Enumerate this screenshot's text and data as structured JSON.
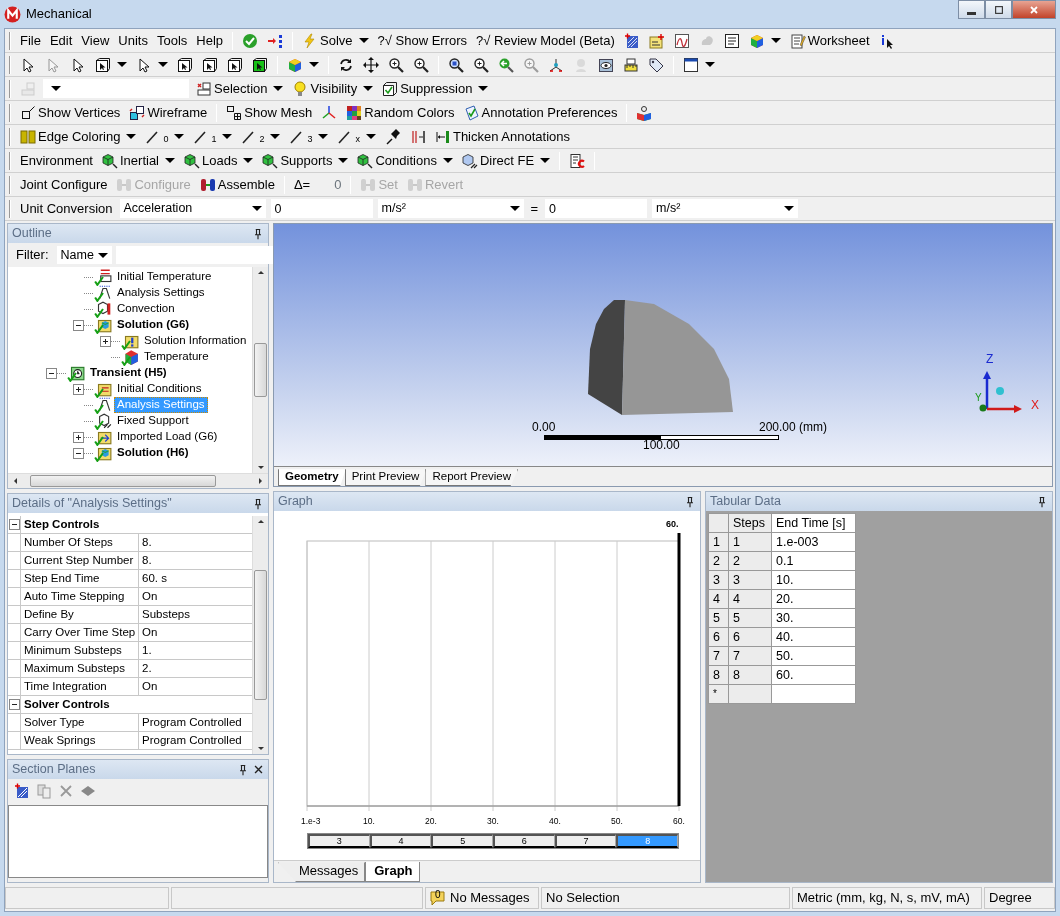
{
  "window": {
    "title": "Mechanical"
  },
  "toolbars": [
    [
      {
        "kind": "menu",
        "label": "File"
      },
      {
        "kind": "menu",
        "label": "Edit"
      },
      {
        "kind": "menu",
        "label": "View"
      },
      {
        "kind": "menu",
        "label": "Units"
      },
      {
        "kind": "menu",
        "label": "Tools"
      },
      {
        "kind": "menu",
        "label": "Help"
      },
      {
        "kind": "sep"
      },
      {
        "kind": "icon",
        "disabled": false
      },
      {
        "kind": "icon",
        "disabled": false
      },
      {
        "kind": "sep"
      },
      {
        "kind": "button",
        "label": "Solve",
        "dropdown": true,
        "disabled": false
      },
      {
        "kind": "text",
        "label": "?√ Show Errors",
        "disabled": false
      },
      {
        "kind": "text",
        "label": "?√ Review Model (Beta)",
        "disabled": false
      },
      {
        "kind": "icon",
        "disabled": false
      },
      {
        "kind": "icon",
        "disabled": false
      },
      {
        "kind": "icon",
        "disabled": false
      },
      {
        "kind": "icon",
        "disabled": true
      },
      {
        "kind": "icon",
        "disabled": false
      },
      {
        "kind": "icon",
        "dropdown": true,
        "disabled": false
      },
      {
        "kind": "button",
        "label": "Worksheet",
        "disabled": false
      },
      {
        "kind": "icon",
        "disabled": false
      }
    ],
    [
      {
        "kind": "icon",
        "disabled": false
      },
      {
        "kind": "icon",
        "disabled": true
      },
      {
        "kind": "icon",
        "disabled": false
      },
      {
        "kind": "icon",
        "dropdown": true,
        "disabled": false
      },
      {
        "kind": "icon",
        "dropdown": true,
        "disabled": false
      },
      {
        "kind": "icon",
        "disabled": false
      },
      {
        "kind": "icon",
        "disabled": false
      },
      {
        "kind": "icon",
        "disabled": false
      },
      {
        "kind": "icon",
        "disabled": false
      },
      {
        "kind": "sep"
      },
      {
        "kind": "icon",
        "dropdown": true,
        "disabled": false
      },
      {
        "kind": "sep"
      },
      {
        "kind": "icon",
        "disabled": false
      },
      {
        "kind": "icon",
        "disabled": false
      },
      {
        "kind": "icon",
        "disabled": false
      },
      {
        "kind": "icon",
        "disabled": false
      },
      {
        "kind": "sep"
      },
      {
        "kind": "icon",
        "disabled": false
      },
      {
        "kind": "icon",
        "disabled": false
      },
      {
        "kind": "icon",
        "disabled": false
      },
      {
        "kind": "icon",
        "disabled": true
      },
      {
        "kind": "icon",
        "disabled": false
      },
      {
        "kind": "icon",
        "disabled": true
      },
      {
        "kind": "icon",
        "disabled": false
      },
      {
        "kind": "icon",
        "disabled": false
      },
      {
        "kind": "icon",
        "disabled": false
      },
      {
        "kind": "sep"
      },
      {
        "kind": "icon",
        "dropdown": true,
        "disabled": false
      }
    ],
    [
      {
        "kind": "icon",
        "disabled": true
      },
      {
        "kind": "combo"
      },
      {
        "kind": "button",
        "label": "Selection",
        "dropdown": true,
        "disabled": false
      },
      {
        "kind": "button",
        "label": "Visibility",
        "dropdown": true,
        "disabled": false
      },
      {
        "kind": "button",
        "label": "Suppression",
        "dropdown": true,
        "disabled": false
      }
    ],
    [
      {
        "kind": "button",
        "label": "Show Vertices",
        "disabled": false
      },
      {
        "kind": "button",
        "label": "Wireframe",
        "disabled": false
      },
      {
        "kind": "sep"
      },
      {
        "kind": "button",
        "label": "Show Mesh",
        "disabled": false
      },
      {
        "kind": "icon",
        "disabled": false
      },
      {
        "kind": "button",
        "label": "Random Colors",
        "disabled": false
      },
      {
        "kind": "button",
        "label": "Annotation Preferences",
        "disabled": false
      },
      {
        "kind": "sep"
      },
      {
        "kind": "icon",
        "disabled": false
      }
    ],
    [
      {
        "kind": "button",
        "label": "Edge Coloring",
        "dropdown": true,
        "disabled": false
      },
      {
        "kind": "sub",
        "label": "0",
        "dropdown": true,
        "disabled": false
      },
      {
        "kind": "sub",
        "label": "1",
        "dropdown": true,
        "disabled": false
      },
      {
        "kind": "sub",
        "label": "2",
        "dropdown": true,
        "disabled": false
      },
      {
        "kind": "sub",
        "label": "3",
        "dropdown": true,
        "disabled": false
      },
      {
        "kind": "sub",
        "label": "x",
        "dropdown": true,
        "disabled": false
      },
      {
        "kind": "icon",
        "disabled": false
      },
      {
        "kind": "icon",
        "disabled": false
      },
      {
        "kind": "button",
        "label": "Thicken Annotations",
        "disabled": false
      }
    ],
    [
      {
        "kind": "label",
        "label": "Environment"
      },
      {
        "kind": "button",
        "label": "Inertial",
        "dropdown": true,
        "disabled": false
      },
      {
        "kind": "button",
        "label": "Loads",
        "dropdown": true,
        "disabled": false
      },
      {
        "kind": "button",
        "label": "Supports",
        "dropdown": true,
        "disabled": false
      },
      {
        "kind": "button",
        "label": "Conditions",
        "dropdown": true,
        "disabled": false
      },
      {
        "kind": "button",
        "label": "Direct FE",
        "dropdown": true,
        "disabled": false
      },
      {
        "kind": "sep"
      },
      {
        "kind": "icon",
        "disabled": false
      },
      {
        "kind": "sep"
      }
    ],
    [
      {
        "kind": "label",
        "label": "Joint Configure"
      },
      {
        "kind": "button",
        "label": "Configure",
        "disabled": true
      },
      {
        "kind": "button",
        "label": "Assemble",
        "disabled": false
      },
      {
        "kind": "sep"
      },
      {
        "kind": "readout",
        "label": "Δ=",
        "value": "0"
      },
      {
        "kind": "sep"
      },
      {
        "kind": "button",
        "label": "Set",
        "disabled": true
      },
      {
        "kind": "button",
        "label": "Revert",
        "disabled": true
      }
    ],
    [
      {
        "kind": "label",
        "label": "Unit Conversion"
      },
      {
        "kind": "combo",
        "value": "Acceleration"
      },
      {
        "kind": "input",
        "value": "0"
      },
      {
        "kind": "combo",
        "value": "m/s²"
      },
      {
        "kind": "label",
        "label": "="
      },
      {
        "kind": "input",
        "value": "0"
      },
      {
        "kind": "combo",
        "value": "m/s²"
      }
    ]
  ],
  "outline": {
    "title": "Outline",
    "filter_label": "Filter:",
    "filter_value": "Name",
    "tree": [
      {
        "children": [
          {
            "label": "Initial Temperature",
            "kind": "load",
            "selected": false
          },
          {
            "label": "Analysis Settings",
            "kind": "settings",
            "selected": false
          },
          {
            "label": "Convection",
            "kind": "convection",
            "selected": false
          },
          {
            "label": "Solution (G6)",
            "kind": "solution",
            "selected": false,
            "expanded": true,
            "children": [
              {
                "label": "Solution Information",
                "kind": "info",
                "selected": false,
                "expanded": false
              },
              {
                "label": "Temperature",
                "kind": "result",
                "selected": false
              }
            ]
          }
        ]
      },
      {
        "label": "Transient (H5)",
        "kind": "analysis",
        "selected": false,
        "expanded": true,
        "children": [
          {
            "label": "Initial Conditions",
            "kind": "conditions",
            "selected": false,
            "expanded": false
          },
          {
            "label": "Analysis Settings",
            "kind": "settings",
            "selected": true
          },
          {
            "label": "Fixed Support",
            "kind": "support",
            "selected": false
          },
          {
            "label": "Imported Load (G6)",
            "kind": "import",
            "selected": false,
            "expanded": false
          },
          {
            "label": "Solution (H6)",
            "kind": "solution",
            "selected": false,
            "expanded": true
          }
        ]
      }
    ]
  },
  "details": {
    "title": "Details of \"Analysis Settings\"",
    "groups": [
      {
        "label": "Step Controls",
        "expanded": true,
        "rows": [
          {
            "name": "Number Of Steps",
            "value": "8."
          },
          {
            "name": "Current Step Number",
            "value": "8."
          },
          {
            "name": "Step End Time",
            "value": "60. s"
          },
          {
            "name": "Auto Time Stepping",
            "value": "On"
          },
          {
            "name": "Define By",
            "value": "Substeps"
          },
          {
            "name": "Carry Over Time Step",
            "value": "On"
          },
          {
            "name": "Minimum Substeps",
            "value": "1."
          },
          {
            "name": "Maximum Substeps",
            "value": "2."
          },
          {
            "name": "Time Integration",
            "value": "On"
          }
        ]
      },
      {
        "label": "Solver Controls",
        "expanded": true,
        "rows": [
          {
            "name": "Solver Type",
            "value": "Program Controlled"
          },
          {
            "name": "Weak Springs",
            "value": "Program Controlled"
          }
        ]
      }
    ]
  },
  "section_planes": {
    "title": "Section Planes"
  },
  "viewport": {
    "scale": {
      "start": "0.00",
      "middle": "100.00",
      "end": "200.00 (mm)"
    },
    "axes": {
      "z": "Z",
      "x": "X",
      "y": "Y"
    },
    "tabs": [
      {
        "label": "Geometry",
        "selected": true
      },
      {
        "label": "Print Preview",
        "selected": false
      },
      {
        "label": "Report Preview",
        "selected": false
      }
    ]
  },
  "graph": {
    "title": "Graph",
    "axis_labels": [
      "1.e-3",
      "10.",
      "20.",
      "30.",
      "40.",
      "50.",
      "60."
    ],
    "marker": "60.",
    "steps": [
      {
        "label": "3",
        "selected": false
      },
      {
        "label": "4",
        "selected": false
      },
      {
        "label": "5",
        "selected": false
      },
      {
        "label": "6",
        "selected": false
      },
      {
        "label": "7",
        "selected": false
      },
      {
        "label": "8",
        "selected": true
      }
    ],
    "tabs": [
      {
        "label": "Messages",
        "selected": false
      },
      {
        "label": "Graph",
        "selected": true
      }
    ]
  },
  "tabular": {
    "title": "Tabular Data",
    "columns": [
      "Steps",
      "End Time [s]"
    ],
    "rows": [
      {
        "index": "1",
        "cells": [
          "1",
          "1.e-003"
        ]
      },
      {
        "index": "2",
        "cells": [
          "2",
          "0.1"
        ]
      },
      {
        "index": "3",
        "cells": [
          "3",
          "10."
        ]
      },
      {
        "index": "4",
        "cells": [
          "4",
          "20."
        ]
      },
      {
        "index": "5",
        "cells": [
          "5",
          "30."
        ]
      },
      {
        "index": "6",
        "cells": [
          "6",
          "40."
        ]
      },
      {
        "index": "7",
        "cells": [
          "7",
          "50."
        ]
      },
      {
        "index": "8",
        "cells": [
          "8",
          "60."
        ]
      }
    ],
    "new_row_marker": "*"
  },
  "status_bar": {
    "message_count": "0",
    "messages": "No Messages",
    "selection": "No Selection",
    "units": "Metric (mm, kg, N, s, mV, mA)",
    "angle": "Degree"
  }
}
